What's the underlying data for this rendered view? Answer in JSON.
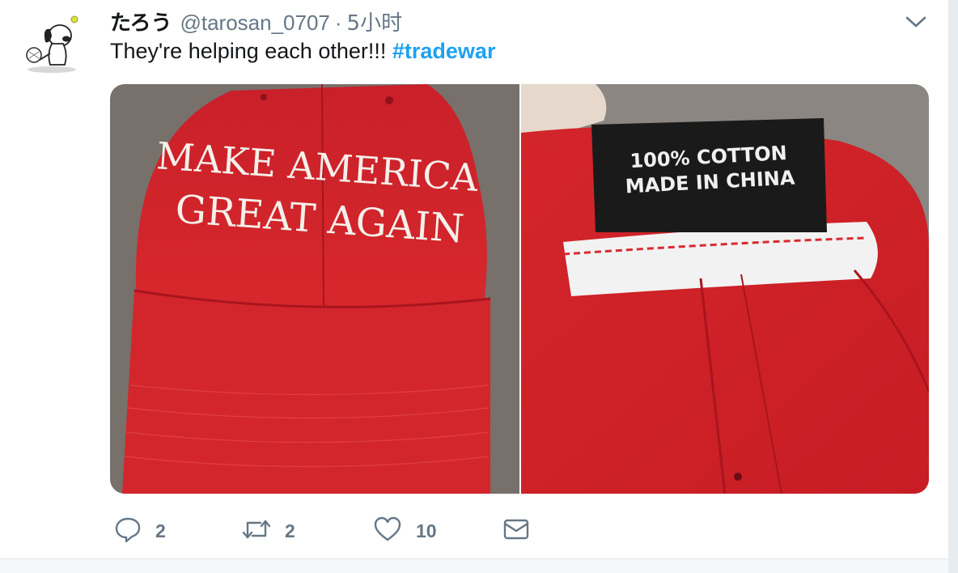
{
  "tweet": {
    "display_name": "たろう",
    "handle": "@tarosan_0707",
    "separator": "·",
    "time": "5小时",
    "text": "They're helping each other!!!",
    "hashtag": "#tradewar"
  },
  "media": {
    "left_image": {
      "line1": "MAKE AMERICA",
      "line2": "GREAT AGAIN"
    },
    "right_image": {
      "line1": "100% COTTON",
      "line2": "MADE IN CHINA"
    }
  },
  "actions": {
    "reply_count": "2",
    "retweet_count": "2",
    "like_count": "10"
  },
  "icons": [
    "snoopy-avatar",
    "chevron-down-icon",
    "reply-icon",
    "retweet-icon",
    "heart-icon",
    "mail-icon"
  ],
  "colors": {
    "link": "#1da1f2",
    "muted": "#657786",
    "cap_red": "#cc1f24",
    "label_black": "#1a1a1a"
  }
}
